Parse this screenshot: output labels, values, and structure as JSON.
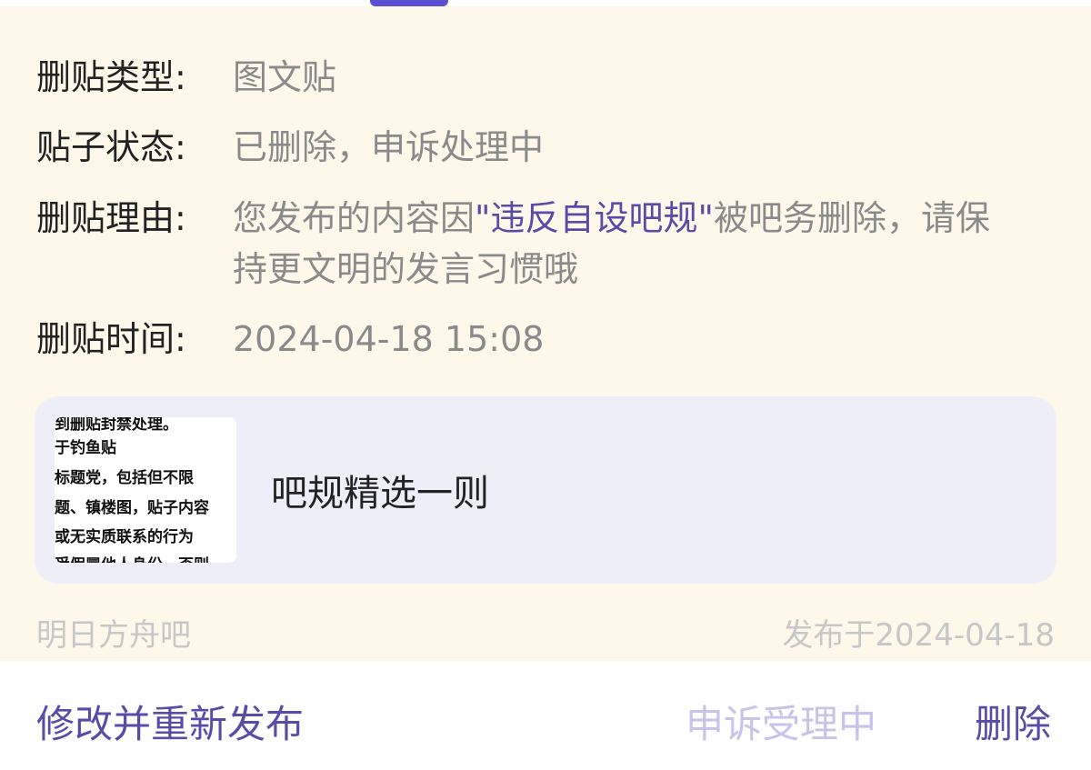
{
  "details": {
    "type_label": "删贴类型:",
    "type_value": "图文贴",
    "status_label": "贴子状态:",
    "status_value": "已删除，申诉处理中",
    "reason_label": "删贴理由:",
    "reason_prefix": "您发布的内容因",
    "reason_highlight": "\"违反自设吧规\"",
    "reason_suffix": "被吧务删除，请保持更文明的发言习惯哦",
    "time_label": "删贴时间:",
    "time_value": "2024-04-18 15:08"
  },
  "linked_post": {
    "thumb_lines": [
      "到删贴封禁处理。",
      "于钓鱼贴",
      "标题党，包括但不限",
      "题、镇楼图，贴子内容",
      "或无实质联系的行为",
      "受假冒他人身份，否则"
    ],
    "title": "吧规精选一则"
  },
  "meta": {
    "forum": "明日方舟吧",
    "published": "发布于2024-04-18"
  },
  "actions": {
    "republish": "修改并重新发布",
    "appeal": "申诉受理中",
    "delete": "删除"
  },
  "colors": {
    "accent": "#5a4ca6",
    "card_bg": "#fdf8ea",
    "linked_bg": "#eeeef9"
  }
}
